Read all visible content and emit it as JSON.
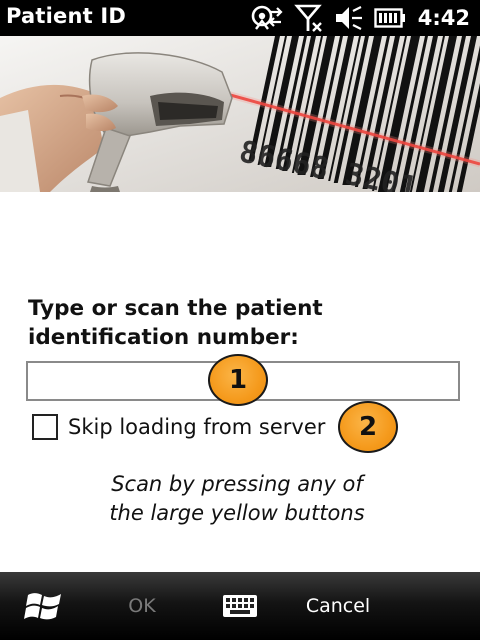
{
  "statusbar": {
    "title": "Patient ID",
    "time": "4:42",
    "icons": [
      "connectivity-icon",
      "signal-off-icon",
      "volume-muted-icon",
      "battery-icon"
    ]
  },
  "banner": {
    "barcode_digits": "86668 3201"
  },
  "form": {
    "prompt_line1": "Type or scan the patient",
    "prompt_line2": "identification number:",
    "id_value": "",
    "skip_label": "Skip loading from server",
    "skip_checked": false,
    "hint_line1": "Scan by pressing any of",
    "hint_line2": "the large yellow buttons"
  },
  "callouts": [
    "1",
    "2"
  ],
  "softbar": {
    "ok_label": "OK",
    "cancel_label": "Cancel",
    "start_icon": "windows-flag-icon",
    "keyboard_icon": "keyboard-icon"
  },
  "colors": {
    "callout": "#F59A1C",
    "laser": "#E8302A",
    "statusbar": "#000000"
  }
}
